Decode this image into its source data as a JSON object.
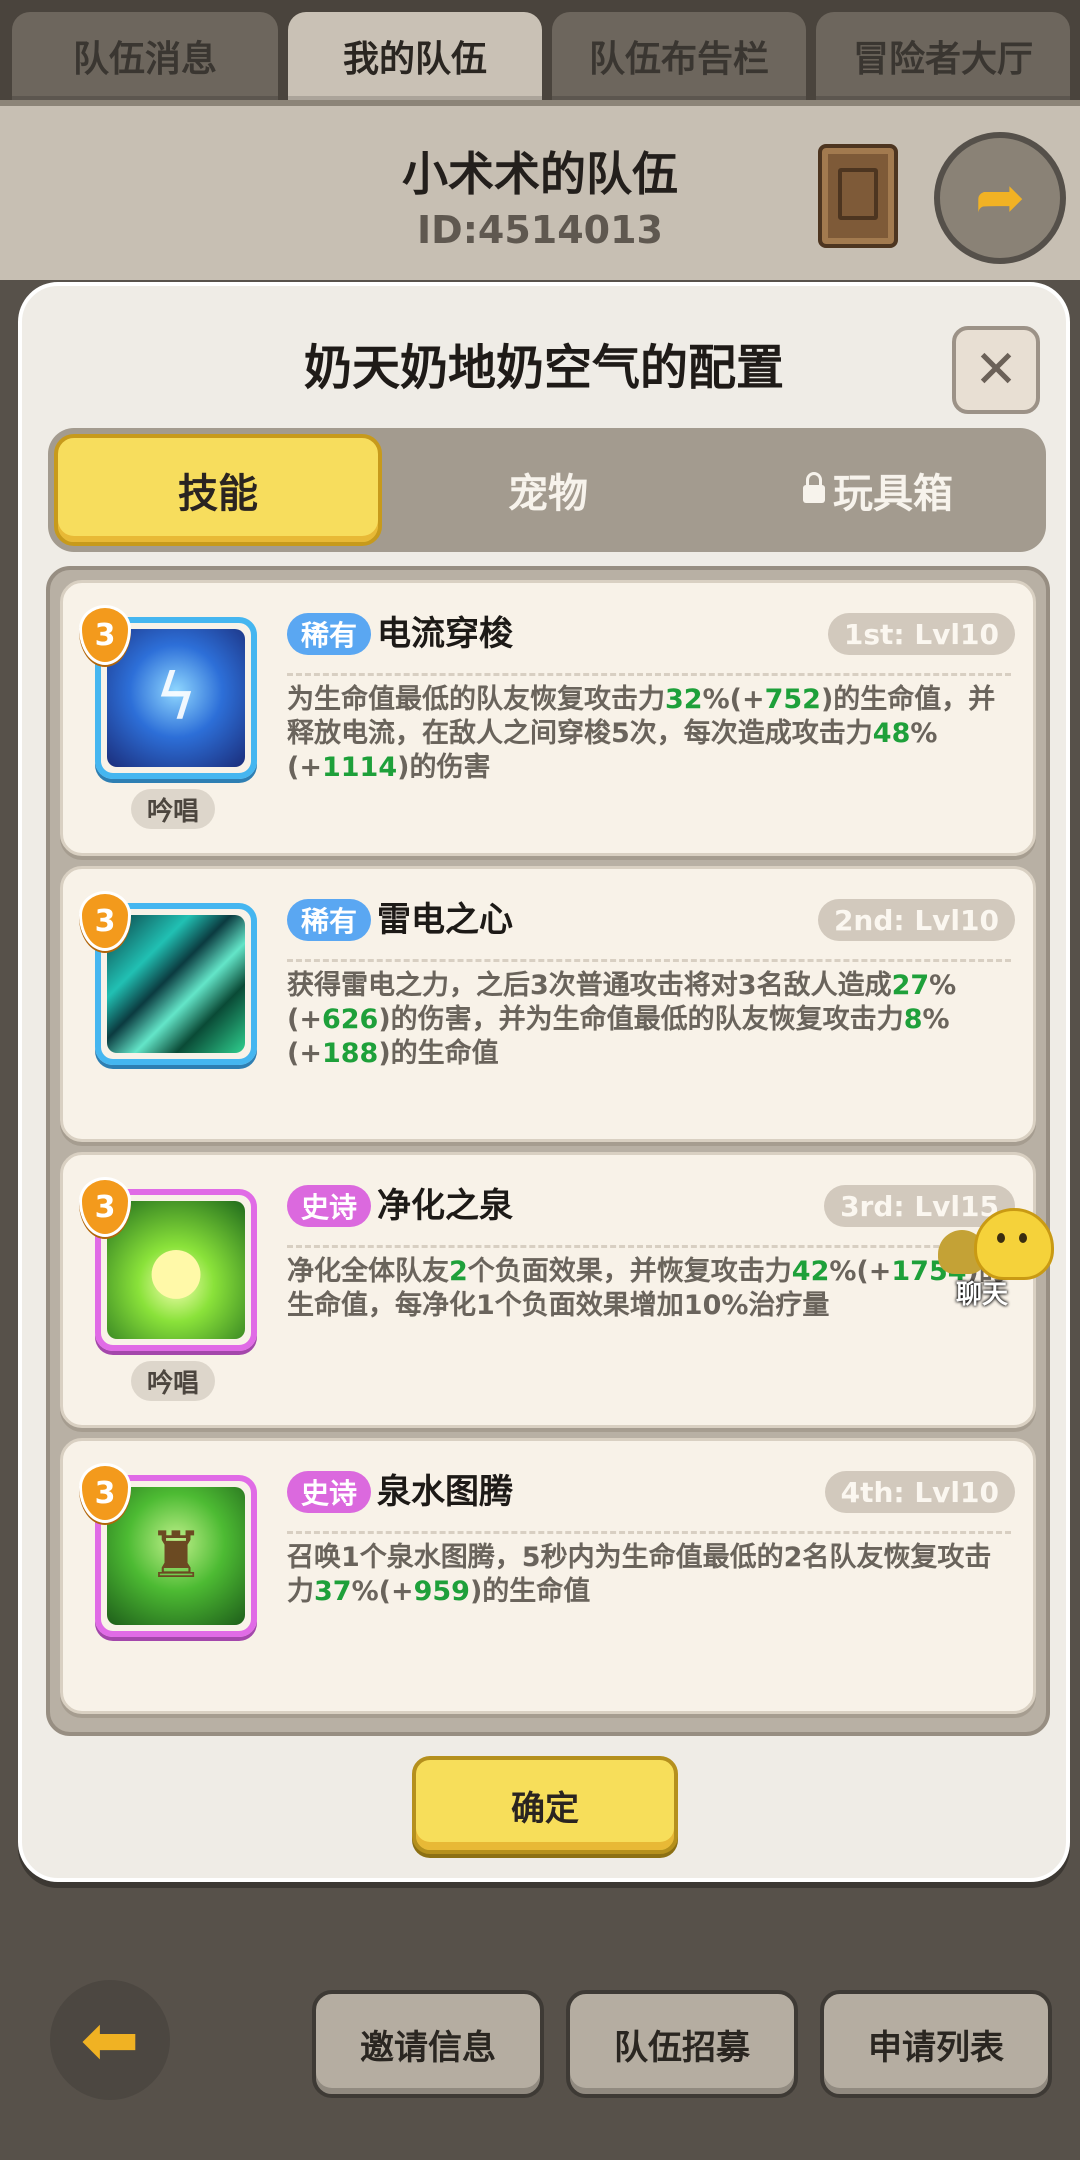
{
  "top_tabs": [
    "队伍消息",
    "我的队伍",
    "队伍布告栏",
    "冒险者大厅"
  ],
  "team": {
    "name": "小术术的队伍",
    "id": "ID:4514013"
  },
  "modal": {
    "title": "奶天奶地奶空气的配置",
    "close_symbol": "✕",
    "segments": [
      "技能",
      "宠物",
      "玩具箱"
    ],
    "confirm_label": "确定"
  },
  "skills": [
    {
      "level_badge": "3",
      "rarity": "稀有",
      "name": "电流穿梭",
      "order": "1st: Lvl10",
      "desc_parts": [
        "为生命值最低的队友恢复攻击力",
        "32",
        "%(+",
        "752",
        ")的生命值，并释放电流，在敌人之间穿梭5次，每次造成攻击力",
        "48",
        "%(+",
        "1114",
        ")的伤害"
      ],
      "tag": "吟唱",
      "icon": "lightning-icon"
    },
    {
      "level_badge": "3",
      "rarity": "稀有",
      "name": "雷电之心",
      "order": "2nd: Lvl10",
      "desc_parts": [
        "获得雷电之力，之后3次普通攻击将对3名敌人造成",
        "27",
        "%(+",
        "626",
        ")的伤害，并为生命值最低的队友恢复攻击力",
        "8",
        "%(+",
        "188",
        ")的生命值"
      ],
      "tag": "",
      "icon": "thunder-heart-icon"
    },
    {
      "level_badge": "3",
      "rarity": "史诗",
      "name": "净化之泉",
      "order": "3rd: Lvl15",
      "desc_parts": [
        "净化全体队友",
        "2",
        "个负面效果，并恢复攻击力",
        "42",
        "%(+",
        "1754",
        ")的生命值，每净化1个负面效果增加10%治疗量"
      ],
      "tag": "吟唱",
      "icon": "spring-drop-icon"
    },
    {
      "level_badge": "3",
      "rarity": "史诗",
      "name": "泉水图腾",
      "order": "4th: Lvl10",
      "desc_parts": [
        "召唤1个泉水图腾，5秒内为生命值最低的2名队友恢复攻击力",
        "37",
        "%(+",
        "959",
        ")的生命值"
      ],
      "tag": "",
      "icon": "totem-icon"
    }
  ],
  "chat_label": "聊天",
  "bottom_buttons": [
    "邀请信息",
    "队伍招募",
    "申请列表"
  ],
  "colors": {
    "accent_yellow": "#f7de5a",
    "rare_blue": "#5aa7f2",
    "epic_pink": "#db69de",
    "value_green": "#1ea03a"
  }
}
